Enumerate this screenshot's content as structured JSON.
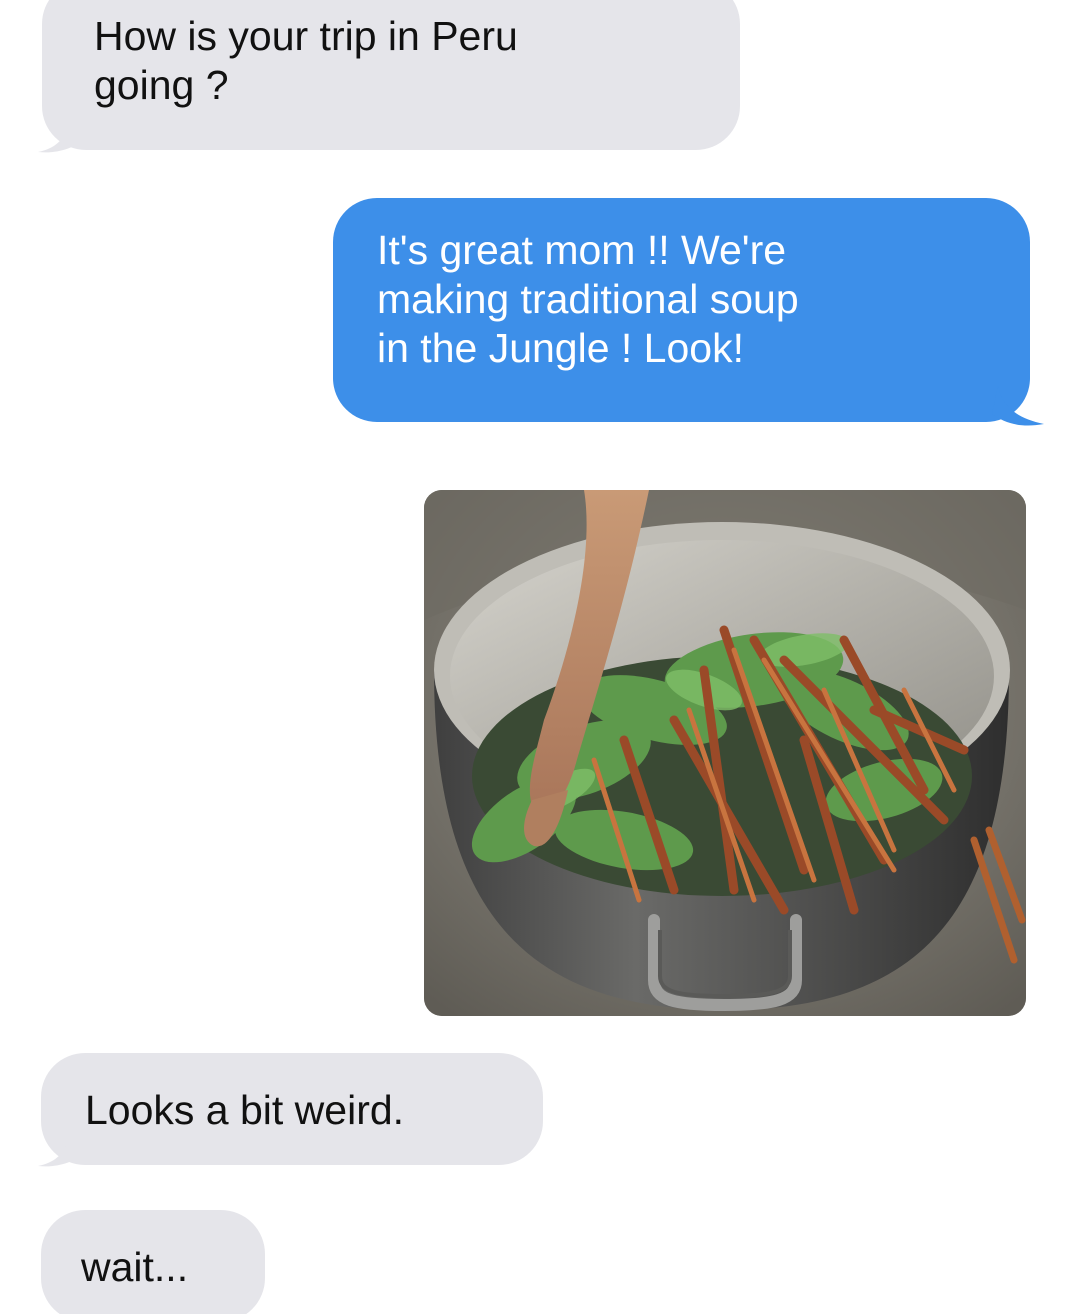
{
  "messages": [
    {
      "sender": "mom",
      "text": "How is your trip in Peru\ngoing ?"
    },
    {
      "sender": "me",
      "text": "It's great mom !! We're\nmaking traditional soup\nin the Jungle ! Look!"
    },
    {
      "sender": "me",
      "attachment": "photo",
      "photo_subject": "pot-of-leaves-and-vines"
    },
    {
      "sender": "mom",
      "text": "Looks a bit weird."
    },
    {
      "sender": "mom",
      "text": "wait..."
    }
  ],
  "colors": {
    "incoming_bubble": "#e5e5ea",
    "outgoing_bubble": "#3d8fe9",
    "incoming_text": "#111111",
    "outgoing_text": "#ffffff",
    "background": "#ffffff"
  }
}
